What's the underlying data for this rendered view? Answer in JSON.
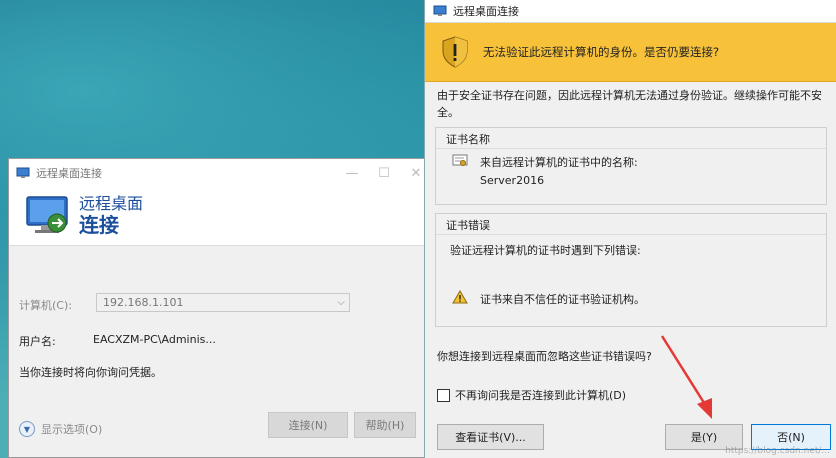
{
  "rdp_window": {
    "title": "远程桌面连接",
    "banner_top": "远程桌面",
    "banner_bottom": "连接",
    "computer_label": "计算机(C):",
    "computer_value": "192.168.1.101",
    "user_label": "用户名:",
    "user_value": "EACXZM-PC\\Adminis...",
    "note": "当你连接时将向你询问凭据。",
    "options_label": "显示选项(O)",
    "connect_button": "连接(N)",
    "help_button": "帮助(H)",
    "minimize_glyph": "—",
    "maximize_glyph": "☐",
    "close_glyph": "✕"
  },
  "security_dialog": {
    "title": "远程桌面连接",
    "warning": "无法验证此远程计算机的身份。是否仍要连接?",
    "description": "由于安全证书存在问题，因此远程计算机无法通过身份验证。继续操作可能不安全。",
    "cert_name_group": {
      "title": "证书名称",
      "line1": "来自远程计算机的证书中的名称:",
      "line2": "Server2016"
    },
    "cert_error_group": {
      "title": "证书错误",
      "line1": "验证远程计算机的证书时遇到下列错误:",
      "error": "证书来自不信任的证书验证机构。"
    },
    "question": "你想连接到远程桌面而忽略这些证书错误吗?",
    "checkbox_label": "不再询问我是否连接到此计算机(D)",
    "view_cert_button": "查看证书(V)...",
    "yes_button": "是(Y)",
    "no_button": "否(N)"
  },
  "colors": {
    "warning_band": "#f7c23a",
    "banner_text": "#1b4f9c",
    "annotation_arrow": "#e53935"
  },
  "watermark": "https://blog.csdn.net/..."
}
